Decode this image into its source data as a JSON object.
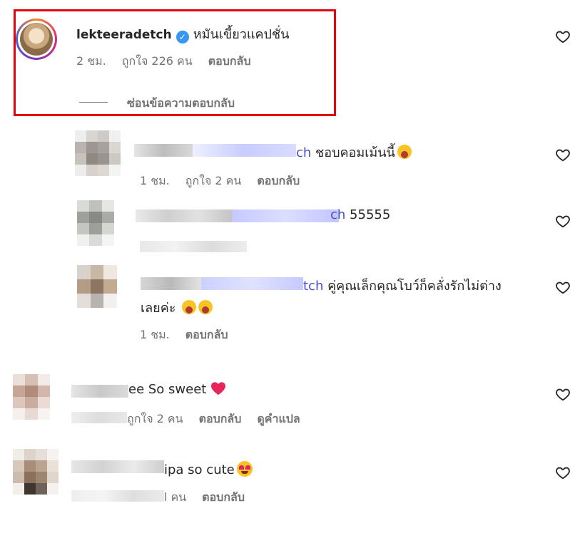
{
  "highlighted_comment": {
    "username": "lekteeradetch",
    "text": "หมันเขี้ยวแคปชั่น",
    "time": "2 ชม.",
    "likes": "ถูกใจ 226 คน",
    "reply_label": "ตอบกลับ",
    "hide_replies_label": "ซ่อนข้อความตอบกลับ"
  },
  "replies": [
    {
      "mention_suffix": "ch",
      "text": "ชอบคอมเม้นนี้",
      "time": "1 ชม.",
      "likes": "ถูกใจ 2 คน",
      "reply_label": "ตอบกลับ"
    },
    {
      "mention_suffix": "ch",
      "text": "55555"
    },
    {
      "mention_suffix": "tch",
      "text_line1": "คู่คุณเล็กคุณโบว์ก็คลั่งรักไม่ต่าง",
      "text_line2": "เลยค่ะ",
      "time": "1 ชม.",
      "reply_label": "ตอบกลับ"
    }
  ],
  "comments": [
    {
      "text": "ee So sweet",
      "likes": "ถูกใจ 2 คน",
      "reply_label": "ตอบกลับ",
      "translate_label": "ดูคำแปล"
    },
    {
      "text": "ipa so cute",
      "likes": "l คน",
      "reply_label": "ตอบกลับ"
    }
  ],
  "icons": {
    "like": "heart-outline-icon",
    "verified": "verified-badge-icon",
    "emoji_laugh": "face-with-tears-of-joy-icon",
    "emoji_heart": "red-heart-icon",
    "emoji_eyes": "heart-eyes-icon"
  },
  "colors": {
    "highlight_border": "#e0060c",
    "verified_blue": "#3897f0",
    "mention_blue": "#4a4fc4",
    "meta_gray": "#737373"
  }
}
